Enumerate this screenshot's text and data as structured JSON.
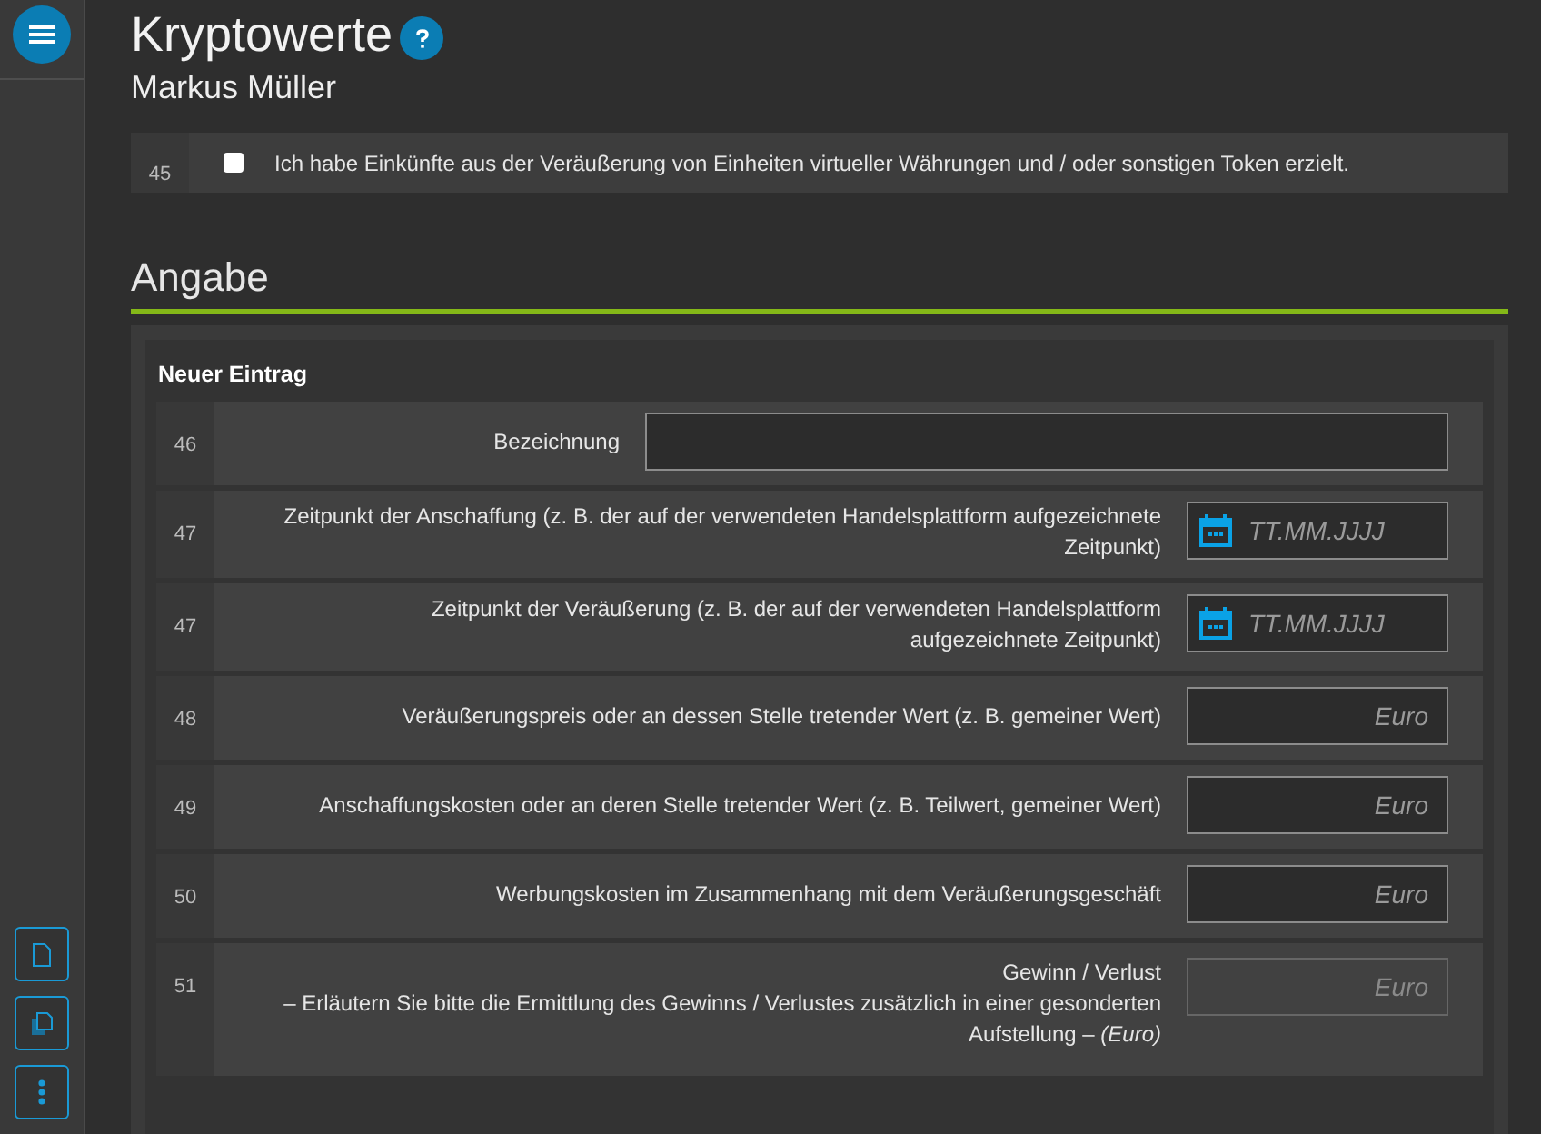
{
  "title": "Kryptowerte",
  "subtitle": "Markus Müller",
  "declaration": {
    "number": "45",
    "label": "Ich habe Einkünfte aus der Veräußerung von Einheiten virtueller Währungen und / oder sonstigen Token erzielt.",
    "checked": false
  },
  "section": {
    "heading": "Angabe",
    "entry_title": "Neuer Eintrag",
    "rows": [
      {
        "number": "46",
        "label": "Bezeichnung",
        "kind": "text",
        "disabled": false
      },
      {
        "number": "47",
        "label": "Zeitpunkt der Anschaffung (z. B. der auf der verwendeten Handelsplattform aufgezeichnete Zeitpunkt)",
        "kind": "date",
        "placeholder": "TT.MM.JJJJ",
        "disabled": false
      },
      {
        "number": "47",
        "label": "Zeitpunkt der Veräußerung (z. B. der auf der verwendeten Handelsplattform aufgezeichnete Zeitpunkt)",
        "kind": "date",
        "placeholder": "TT.MM.JJJJ",
        "disabled": false
      },
      {
        "number": "48",
        "label": "Veräußerungspreis oder an dessen Stelle tretender Wert (z. B. gemeiner Wert)",
        "kind": "amount",
        "placeholder": "Euro",
        "disabled": false
      },
      {
        "number": "49",
        "label": "Anschaffungskosten oder an deren Stelle tretender Wert (z. B. Teilwert, gemeiner Wert)",
        "kind": "amount",
        "placeholder": "Euro",
        "disabled": false
      },
      {
        "number": "50",
        "label": "Werbungskosten im Zusammenhang mit dem Veräußerungsgeschäft",
        "kind": "amount",
        "placeholder": "Euro",
        "disabled": false
      },
      {
        "number": "51",
        "label": "Gewinn / Verlust",
        "note": "– Erläutern Sie bitte die Ermittlung des Gewinns / Verlustes zusätzlich in einer gesonderten Aufstellung – *(Euro)*",
        "kind": "amount",
        "placeholder": "Euro",
        "disabled": true
      }
    ]
  }
}
